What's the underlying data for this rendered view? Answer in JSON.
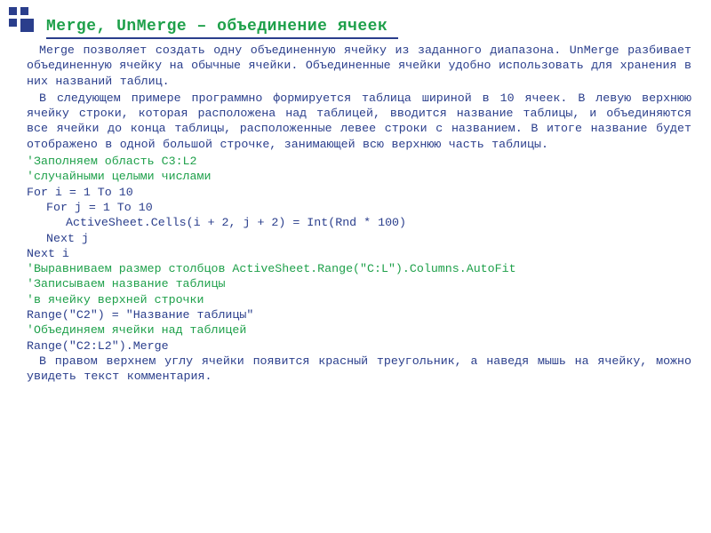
{
  "heading": "Merge, UnMerge – объединение ячеек",
  "paragraphs": {
    "p1": "Merge позволяет создать одну объединенную ячейку из заданного диапазона. UnMerge разбивает объединенную ячейку на обычные ячейки. Объединенные ячейки удобно использовать для хранения в них названий таблиц.",
    "p2": "В следующем примере программно формируется таблица шириной в 10 ячеек. В левую верхнюю ячейку строки, которая расположена над таблицей, вводится название таблицы, и объединяются все ячейки до конца таблицы, расположенные левее строки с названием. В итоге название будет отображено в одной большой строчке, занимающей всю верхнюю часть таблицы.",
    "p3": "В правом верхнем углу ячейки появится красный треугольник, а наведя мышь на ячейку, можно увидеть текст комментария."
  },
  "code": {
    "c01": "'Заполняем область С3:L2",
    "c02": "'случайными целыми числами",
    "c03": "For i = 1 To 10",
    "c04": "For j = 1 To 10",
    "c05": "ActiveSheet.Cells(i + 2, j + 2) = Int(Rnd * 100)",
    "c06": "Next j",
    "c07": "Next i",
    "c08": "'Выравниваем размер столбцов ActiveSheet.Range(\"C:L\").Columns.AutoFit",
    "c09": "'Записываем название таблицы",
    "c10": "'в ячейку верхней строчки",
    "c11": "Range(\"C2\") = \"Название таблицы\"",
    "c12": "'Объединяем ячейки над таблицей",
    "c13": "Range(\"C2:L2\").Merge"
  }
}
